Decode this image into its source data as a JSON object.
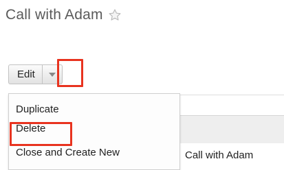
{
  "record": {
    "title": "Call with Adam",
    "favorite_icon": "star-outline-icon",
    "subject_label": "Call with Adam"
  },
  "actions": {
    "edit_label": "Edit",
    "dropdown_icon": "chevron-down-icon",
    "menu": [
      {
        "label": "Duplicate"
      },
      {
        "label": "Delete"
      },
      {
        "label": "Close and Create New"
      }
    ]
  },
  "colors": {
    "highlight": "#e8331f",
    "title_text": "#5a5a5a"
  }
}
